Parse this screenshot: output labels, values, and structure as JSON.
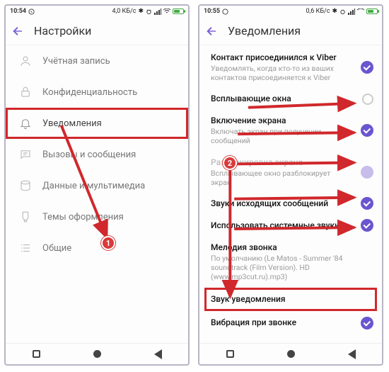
{
  "left": {
    "status": {
      "time": "10:54",
      "net": "4,0 КБ/с"
    },
    "header": {
      "title": "Настройки"
    },
    "items": [
      {
        "label": "Учётная запись"
      },
      {
        "label": "Конфиденциальность"
      },
      {
        "label": "Уведомления"
      },
      {
        "label": "Вызовы и сообщения"
      },
      {
        "label": "Данные и мультимедиа"
      },
      {
        "label": "Темы оформления"
      },
      {
        "label": "Общие"
      }
    ],
    "badge": "1"
  },
  "right": {
    "status": {
      "time": "10:55",
      "net": "0,6 КБ/с"
    },
    "header": {
      "title": "Уведомления"
    },
    "rows": [
      {
        "title": "Контакт присоединился к Viber",
        "sub": "Уведомлять, когда кто-то из ваших контактов присоединяется к Viber",
        "toggle": "on"
      },
      {
        "title": "Всплывающие окна",
        "toggle": "off"
      },
      {
        "title": "Включение экрана",
        "sub": "Включать экран при получении сообщений",
        "toggle": "on"
      },
      {
        "title": "Разблокировка экрана",
        "sub": "Всплывающее окно разблокирует экран",
        "toggle": "dim"
      },
      {
        "title": "Звуки исходящих сообщений",
        "toggle": "on"
      },
      {
        "title": "Использовать системные звуки",
        "toggle": "on"
      },
      {
        "title": "Мелодия звонка",
        "sub": "По умолчанию (Le Matos - Summer '84 soundtrack (Film Version). HD (www.mp3cut.ru).mp3)"
      },
      {
        "title": "Звук уведомления"
      },
      {
        "title": "Вибрация при звонке",
        "toggle": "on"
      }
    ],
    "badge": "2"
  }
}
